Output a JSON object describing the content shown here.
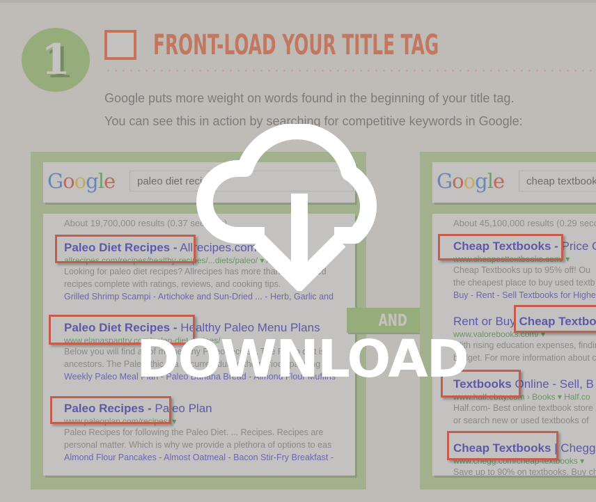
{
  "step": {
    "number": "1",
    "title": "FRONT-LOAD YOUR TITLE TAG"
  },
  "intro": {
    "line1": "Google puts more weight on words found in the beginning of your title tag.",
    "line2": "You can see this in action by searching for competitive keywords in Google:"
  },
  "left_panel": {
    "query": "paleo diet recipes",
    "count": "About 19,700,000 results (0.37 seconds)",
    "results": [
      {
        "title_highlight": "Paleo Diet Recipes -",
        "title_rest": " Allrecipes.com",
        "url": "allrecipes.com/recipes/healthy-recipes/...diets/paleo/ ▾  Allr",
        "desc1": "Looking for paleo diet recipes? Allrecipes has more than 180 trusted",
        "desc2": "recipes complete with ratings, reviews, and cooking tips.",
        "sitelinks": "Grilled Shrimp Scampi - Artichoke and Sun-Dried ... - Herb, Garlic and"
      },
      {
        "title_highlight": "Paleo Diet Recipes -",
        "title_rest": " Healthy Paleo Menu Plans",
        "url": "www.elanaspantry.com/paleo-diet-recipes/ ▾",
        "desc1": "Below you will find all of my healthy Paleo recipes. The Paleo diet is",
        "desc2": "ancestors. The Paleolithic era occurred during the period spanning",
        "sitelinks": "Weekly Paleo Meal Plan - Paleo Banana Bread - Almond Flour Muffins"
      },
      {
        "title_highlight": "Paleo Recipes -",
        "title_rest": " Paleo Plan",
        "url": "www.paleoplan.com/recipes/ ▾",
        "desc1": "Paleo Recipes for following the Paleo Diet. ... Recipes. Recipes are",
        "desc2": "personal matter. Which is why we provide a plethora of options to eas",
        "sitelinks": "Almond Flour Pancakes - Almost Oatmeal - Bacon Stir-Fry Breakfast -"
      }
    ]
  },
  "and_label": "AND",
  "right_panel": {
    "query": "cheap textbooks",
    "count": "About 45,100,000 results (0.29 seconds)",
    "results": [
      {
        "title_highlight": "Cheap Textbooks -",
        "title_rest": " Price C",
        "url": "www.cheapesttextbooks.com/ ▾",
        "desc1": "Cheap Textbooks up to 95% off! Ou",
        "desc2": "the cheapest place to buy used textb",
        "sitelinks": "Buy - Rent - Sell Textbooks for Highes"
      },
      {
        "title_prefix": "Rent or Buy ",
        "title_highlight": "Cheap Textbo",
        "url": "www.valorebooks.com/ ▾",
        "desc1": "With rising education expenses, findin",
        "desc2": "budget. For more information about c"
      },
      {
        "title_highlight": "Textbooks",
        "title_rest": " Online - Sell, B",
        "url": "www.half.ebay.com › Books ▾  Half.co",
        "desc1": "Half.com- Best online textbook store",
        "desc2": "or search new or used textbooks of"
      },
      {
        "title_highlight": "Cheap Textbooks",
        "title_rest": " | Chegg",
        "url": "www.chegg.com/cheap-textbooks ▾",
        "desc1": "Save up to 90% on textbooks. Buy ch"
      }
    ]
  },
  "overlay": {
    "icon": "cloud-download-icon",
    "label": "DOWNLOAD"
  },
  "colors": {
    "background": "#bfbcb7",
    "accent_green": "#97ac7b",
    "accent_orange": "#c27860",
    "highlight_red": "#c55d4a",
    "link_purple": "#5e58a8"
  }
}
